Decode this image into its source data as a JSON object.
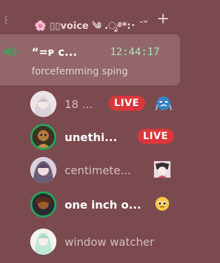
{
  "header": {
    "prefix": "꒰",
    "channel_name": "🌸 ▯▯voice ༄ .ೃ࿔*:･ ˘",
    "chevron": "⌄",
    "plus": "+"
  },
  "now_playing": {
    "title": "“=ᴘ c...",
    "time": "12:44:17",
    "subtitle": "forcefemming sping"
  },
  "members": [
    {
      "name": "18 ...",
      "live": true,
      "live_label": "LIVE",
      "speaking": false,
      "style": "dim"
    },
    {
      "name": "unethi...",
      "live": true,
      "live_label": "LIVE",
      "speaking": true,
      "style": "bold"
    },
    {
      "name": "centimete...",
      "live": false,
      "speaking": false,
      "style": "dim"
    },
    {
      "name": "one inch o...",
      "live": false,
      "speaking": true,
      "style": "bold"
    },
    {
      "name": "window watcher",
      "live": false,
      "speaking": false,
      "style": "dim"
    }
  ],
  "colors": {
    "background": "#7b4a4e",
    "highlight": "#93676a",
    "live": "#da373c",
    "speaking_ring": "#23a55a",
    "timer": "#a6e3b2"
  }
}
